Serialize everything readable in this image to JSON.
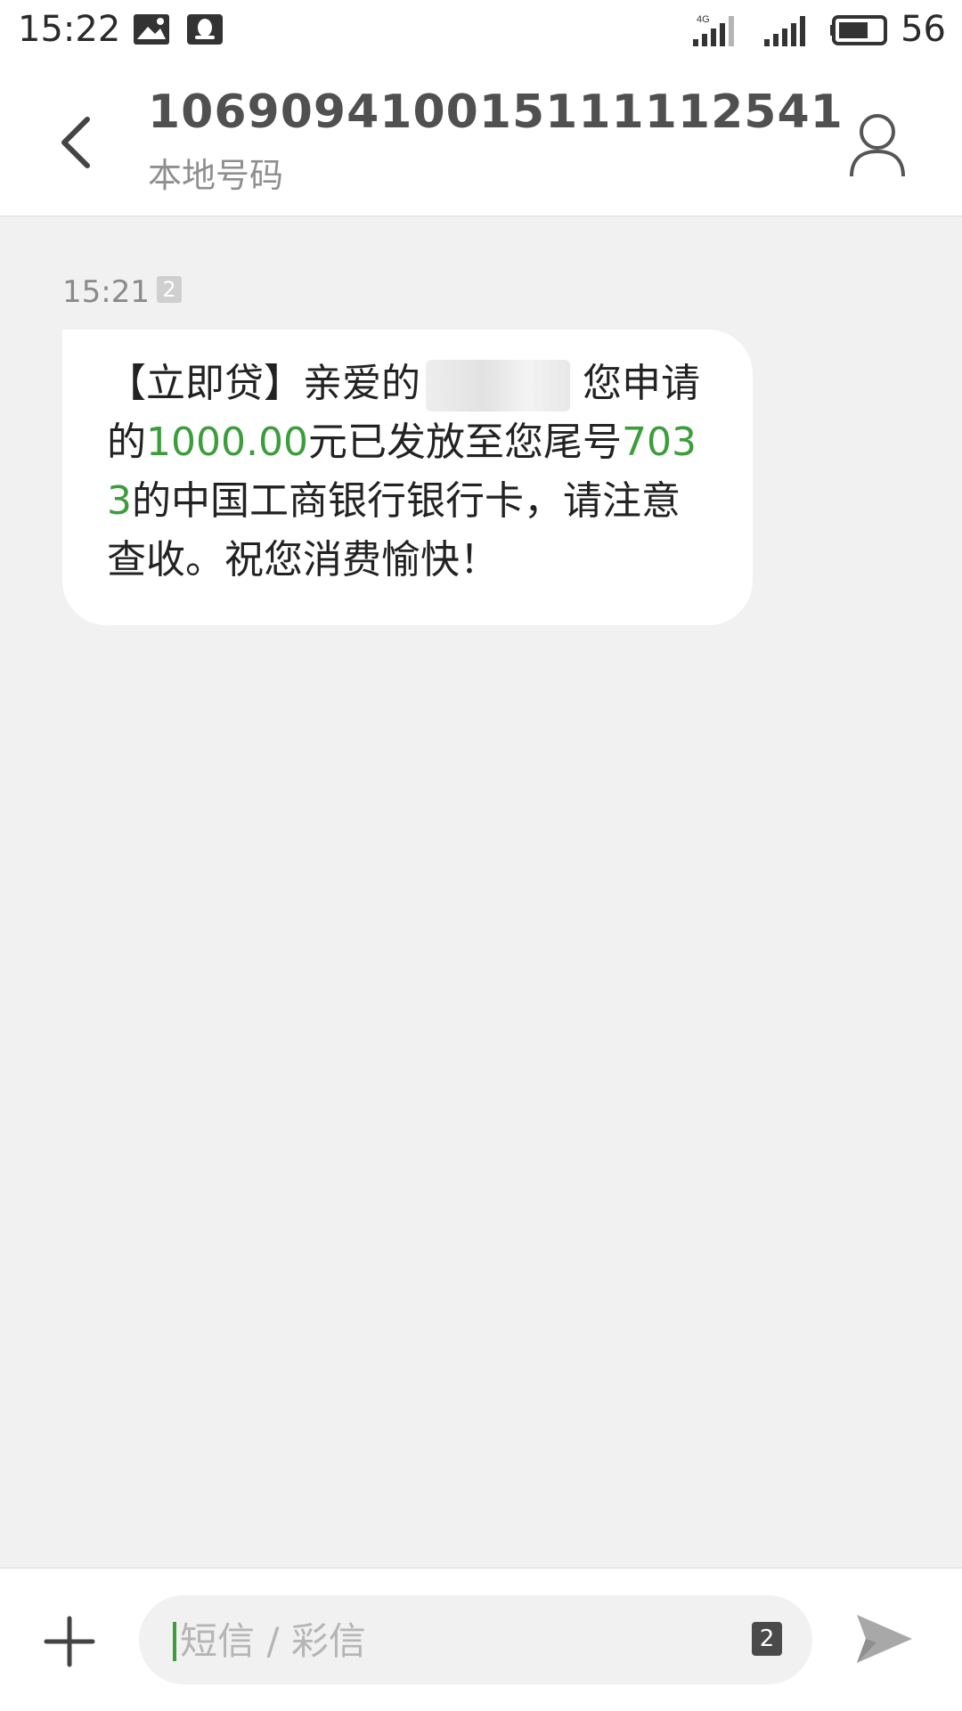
{
  "status_bar": {
    "time": "15:22",
    "network_label": "4G",
    "battery": "56",
    "icons": [
      "image-notification-icon",
      "qq-icon",
      "signal-4g-icon",
      "signal-icon",
      "battery-icon"
    ]
  },
  "header": {
    "title": "106909410015111112541",
    "subtitle": "本地号码",
    "back_icon": "chevron-left-icon",
    "contact_icon": "person-icon"
  },
  "conversation": {
    "messages": [
      {
        "time": "15:21",
        "sim": "2",
        "text_parts": {
          "p1": "【立即贷】亲爱的",
          "p2": "您申请的",
          "amount": "1000.00",
          "p3": "元已发放至您尾号",
          "card_tail": "7033",
          "p4": "的中国工商银行银行卡，请注意查收。祝您消费愉快！"
        }
      }
    ]
  },
  "composer": {
    "placeholder": "短信 / 彩信",
    "sim": "2",
    "add_icon": "plus-icon",
    "send_icon": "send-icon"
  },
  "colors": {
    "accent_green": "#3b9d3b",
    "background": "#f1f1f1"
  }
}
